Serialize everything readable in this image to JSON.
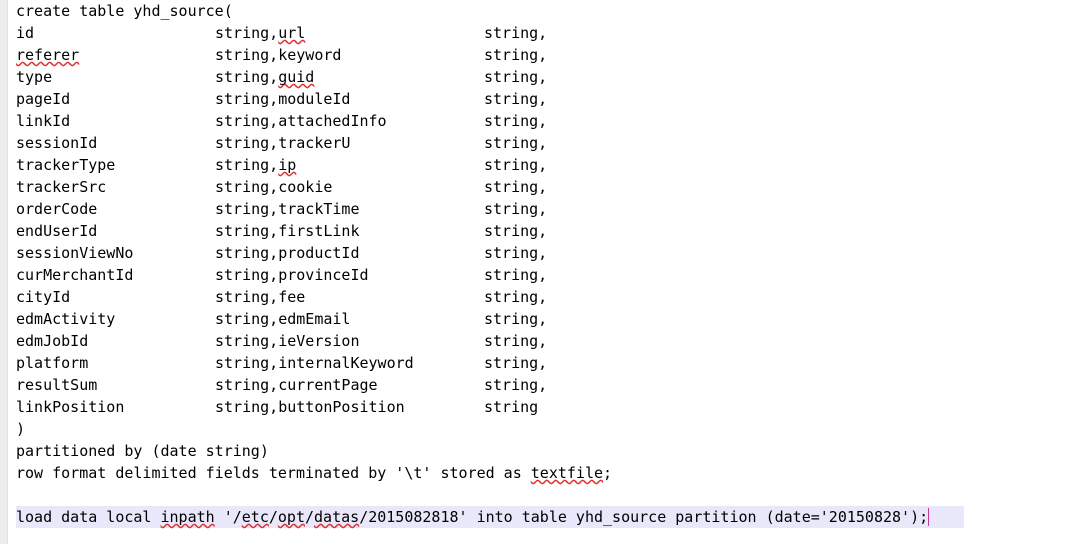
{
  "editor": {
    "background_color": "#ffffff",
    "text_color": "#000000",
    "gutter_color": "#ececec",
    "active_line_color": "#e8e8fa",
    "caret_color": "#c23b9b",
    "spellcheck_underline_color": "#e03030",
    "font_size_px": 15,
    "line_height_px": 22
  },
  "code": {
    "header_line": "create table yhd_source(",
    "columns": [
      {
        "name": "id",
        "type1": "string,",
        "field2": "url",
        "type2": "string,"
      },
      {
        "name": "referer",
        "type1": "string,",
        "field2": "keyword",
        "type2": "string,"
      },
      {
        "name": "type",
        "type1": "string,",
        "field2": "guid",
        "type2": "string,"
      },
      {
        "name": "pageId",
        "type1": "string,",
        "field2": "moduleId",
        "type2": "string,"
      },
      {
        "name": "linkId",
        "type1": "string,",
        "field2": "attachedInfo",
        "type2": "string,"
      },
      {
        "name": "sessionId",
        "type1": "string,",
        "field2": "trackerU",
        "type2": "string,"
      },
      {
        "name": "trackerType",
        "type1": "string,",
        "field2": "ip",
        "type2": "string,"
      },
      {
        "name": "trackerSrc",
        "type1": "string,",
        "field2": "cookie",
        "type2": "string,"
      },
      {
        "name": "orderCode",
        "type1": "string,",
        "field2": "trackTime",
        "type2": "string,"
      },
      {
        "name": "endUserId",
        "type1": "string,",
        "field2": "firstLink",
        "type2": "string,"
      },
      {
        "name": "sessionViewNo",
        "type1": "string,",
        "field2": "productId",
        "type2": "string,"
      },
      {
        "name": "curMerchantId",
        "type1": "string,",
        "field2": "provinceId",
        "type2": "string,"
      },
      {
        "name": "cityId",
        "type1": "string,",
        "field2": "fee",
        "type2": "string,"
      },
      {
        "name": "edmActivity",
        "type1": "string,",
        "field2": "edmEmail",
        "type2": "string,"
      },
      {
        "name": "edmJobId",
        "type1": "string,",
        "field2": "ieVersion",
        "type2": "string,"
      },
      {
        "name": "platform",
        "type1": "string,",
        "field2": "internalKeyword",
        "type2": "string,"
      },
      {
        "name": "resultSum",
        "type1": "string,",
        "field2": "currentPage",
        "type2": "string,"
      },
      {
        "name": "linkPosition",
        "type1": "string,",
        "field2": "buttonPosition",
        "type2": "string"
      }
    ],
    "close_paren": ")",
    "partitioned_by": "partitioned by (date string)",
    "row_format": "row format delimited fields terminated by '\\t' stored as textfile;",
    "load_statement": "load data local inpath '/etc/opt/datas/2015082818' into table yhd_source partition (date='20150828');"
  },
  "spellcheck_words": [
    "referer",
    "url",
    "guid",
    "ip",
    "textfile",
    "inpath",
    "etc",
    "opt",
    "datas"
  ]
}
